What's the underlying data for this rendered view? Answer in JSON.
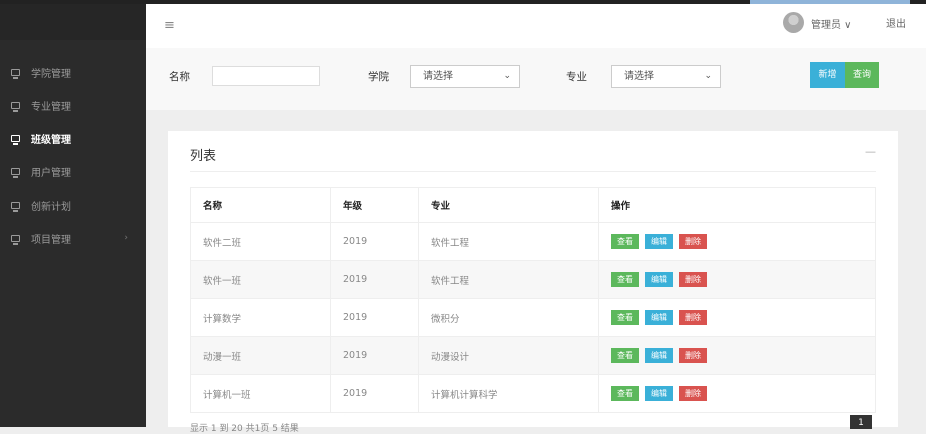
{
  "header": {
    "admin_label": "管理员 ∨",
    "logout_label": "退出"
  },
  "sidebar": {
    "items": [
      {
        "label": "学院管理"
      },
      {
        "label": "专业管理"
      },
      {
        "label": "班级管理"
      },
      {
        "label": "用户管理"
      },
      {
        "label": "创新计划"
      },
      {
        "label": "项目管理",
        "chevron": "›"
      }
    ]
  },
  "search": {
    "name_label": "名称",
    "college_label": "学院",
    "college_value": "请选择",
    "major_label": "专业",
    "major_value": "请选择",
    "add_label": "新增",
    "query_label": "查询"
  },
  "panel": {
    "title": "列表",
    "collapse": "—",
    "columns": [
      "名称",
      "年级",
      "专业",
      "操作"
    ],
    "rows": [
      {
        "name": "软件二班",
        "grade": "2019",
        "major": "软件工程"
      },
      {
        "name": "软件一班",
        "grade": "2019",
        "major": "软件工程"
      },
      {
        "name": "计算数学",
        "grade": "2019",
        "major": "微积分"
      },
      {
        "name": "动漫一班",
        "grade": "2019",
        "major": "动漫设计"
      },
      {
        "name": "计算机一班",
        "grade": "2019",
        "major": "计算机计算科学"
      }
    ],
    "actions": {
      "view": "查看",
      "edit": "编辑",
      "delete": "删除"
    },
    "footer": "显示 1 到 20 共1页 5 结果",
    "page": "1"
  },
  "colors": {
    "sidebar": "#2b2b2b",
    "add": "#3ab0d8",
    "query": "#5cb85c",
    "delete": "#d9534f"
  }
}
